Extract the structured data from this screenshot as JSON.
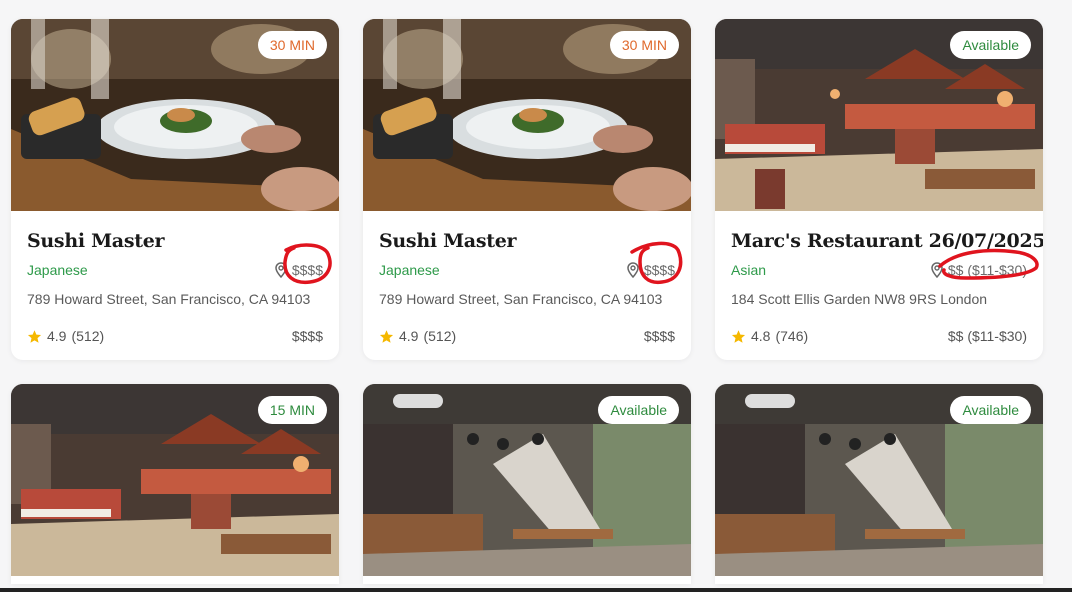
{
  "cards": [
    {
      "badge": "30 MIN",
      "badge_color": "#e0692c",
      "title": "Sushi Master",
      "cuisine": "Japanese",
      "price_tag": "$$$$",
      "address": "789 Howard Street, San Francisco, CA 94103",
      "rating": "4.9",
      "reviews": "(512)",
      "price": "$$$$"
    },
    {
      "badge": "30 MIN",
      "badge_color": "#e0692c",
      "title": "Sushi Master",
      "cuisine": "Japanese",
      "price_tag": "$$$$",
      "address": "789 Howard Street, San Francisco, CA 94103",
      "rating": "4.9",
      "reviews": "(512)",
      "price": "$$$$"
    },
    {
      "badge": "Available",
      "badge_color": "#2e8b3e",
      "title": "Marc's Restaurant 26/07/2025",
      "cuisine": "Asian",
      "price_tag": "$$ ($11-$30)",
      "address": "184 Scott Ellis Garden NW8 9RS London",
      "rating": "4.8",
      "reviews": "(746)",
      "price": "$$ ($11-$30)"
    },
    {
      "badge": "15 MIN",
      "badge_color": "#2e8b3e"
    },
    {
      "badge": "Available",
      "badge_color": "#2e8b3e"
    },
    {
      "badge": "Available",
      "badge_color": "#2e8b3e"
    }
  ],
  "icons": {
    "location": "map-pin-icon",
    "rating": "star-icon"
  },
  "colors": {
    "accent_green": "#2e9a4a",
    "star": "#f5b800",
    "annotation": "#e0141e"
  }
}
